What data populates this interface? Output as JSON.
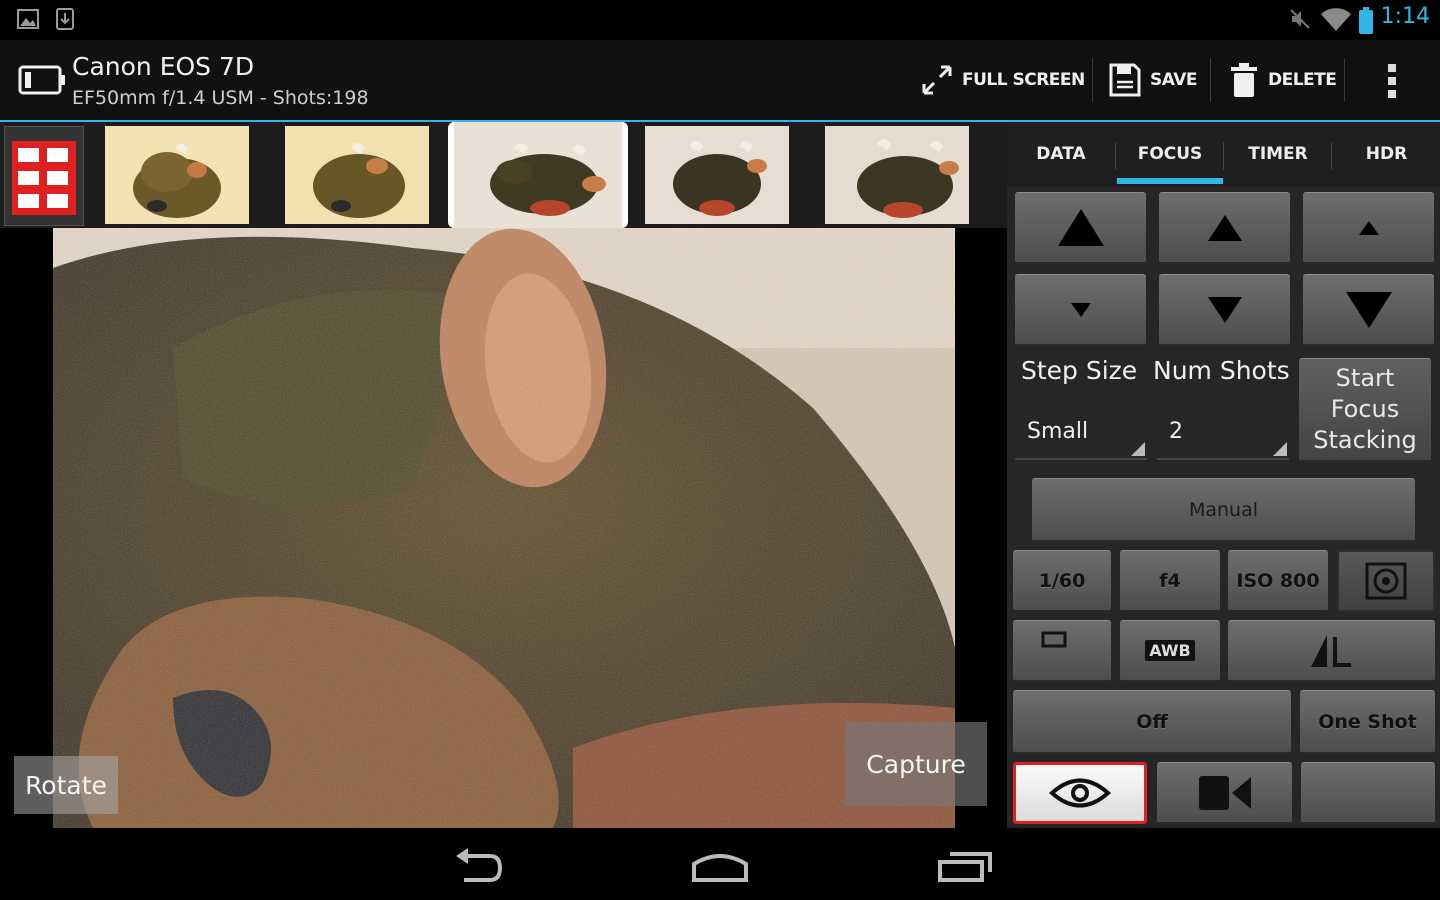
{
  "status_bar": {
    "time": "1:14",
    "icons": [
      "gallery-icon",
      "download-icon",
      "mute-icon",
      "wifi-icon",
      "battery-icon"
    ],
    "accent_color": "#33b5e5"
  },
  "action_bar": {
    "camera_name": "Canon EOS 7D",
    "camera_info": "EF50mm f/1.4 USM - Shots:198",
    "full_screen_label": "FULL SCREEN",
    "save_label": "SAVE",
    "delete_label": "DELETE"
  },
  "thumbnails": {
    "count": 5,
    "selected_index": 2
  },
  "viewer": {
    "rotate_label": "Rotate",
    "capture_label": "Capture"
  },
  "tabs": [
    {
      "label": "DATA",
      "active": false
    },
    {
      "label": "FOCUS",
      "active": true
    },
    {
      "label": "TIMER",
      "active": false
    },
    {
      "label": "HDR",
      "active": false
    }
  ],
  "focus": {
    "step_size_label": "Step Size",
    "num_shots_label": "Num Shots",
    "step_size_value": "Small",
    "num_shots_value": "2",
    "start_button": "Start Focus Stacking",
    "mode_button": "Manual",
    "shutter": "1/60",
    "aperture": "f4",
    "iso": "ISO 800",
    "white_balance": "AWB",
    "drive_value": "Off",
    "af_mode": "One Shot"
  },
  "navigation": {
    "icons": [
      "back-icon",
      "home-icon",
      "recent-apps-icon"
    ]
  }
}
